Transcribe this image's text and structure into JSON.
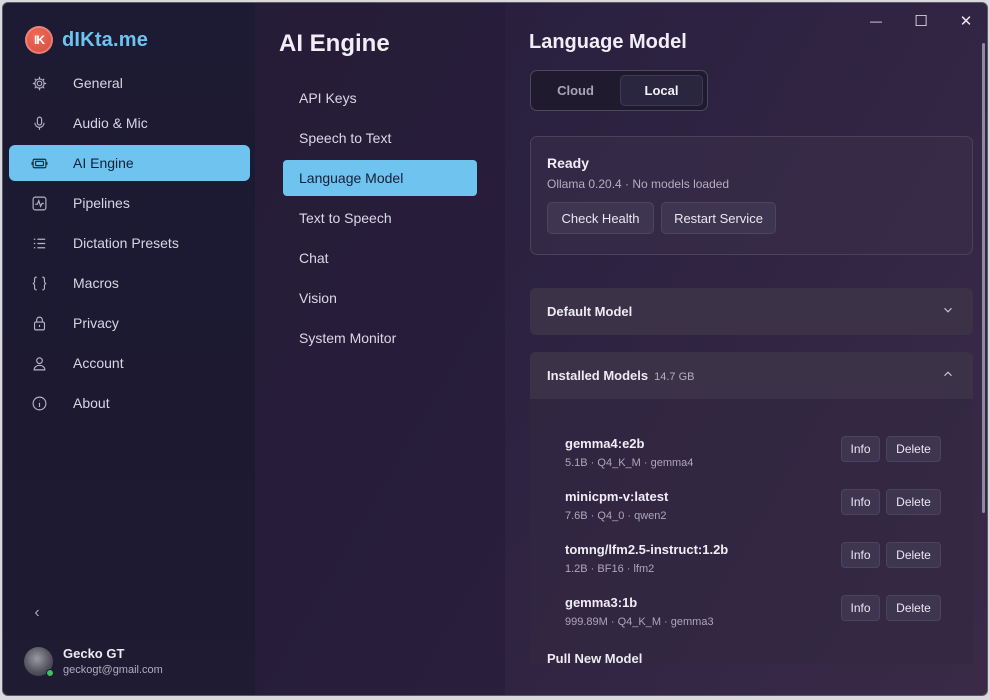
{
  "app": {
    "name": "dIKta.me",
    "logo_text": "IK"
  },
  "sidebar": {
    "items": [
      {
        "label": "General",
        "icon": "gear-icon"
      },
      {
        "label": "Audio & Mic",
        "icon": "microphone-icon"
      },
      {
        "label": "AI Engine",
        "icon": "chip-icon",
        "active": true
      },
      {
        "label": "Pipelines",
        "icon": "activity-icon"
      },
      {
        "label": "Dictation Presets",
        "icon": "list-icon"
      },
      {
        "label": "Macros",
        "icon": "braces-icon"
      },
      {
        "label": "Privacy",
        "icon": "lock-icon"
      },
      {
        "label": "Account",
        "icon": "user-icon"
      },
      {
        "label": "About",
        "icon": "info-icon"
      }
    ],
    "collapse_glyph": "‹"
  },
  "user": {
    "name": "Gecko GT",
    "email": "geckogt@gmail.com"
  },
  "subnav": {
    "title": "AI Engine",
    "items": [
      "API Keys",
      "Speech to Text",
      "Language Model",
      "Text to Speech",
      "Chat",
      "Vision",
      "System Monitor"
    ],
    "active": "Language Model"
  },
  "main": {
    "title": "Language Model",
    "segments": [
      "Cloud",
      "Local"
    ],
    "active_segment": "Local",
    "status": {
      "title": "Ready",
      "meta": "Ollama  0.20.4  ·  No models loaded",
      "check_health": "Check Health",
      "restart_service": "Restart Service"
    },
    "default_model": {
      "label": "Default Model"
    },
    "installed": {
      "label": "Installed Models",
      "size": "14.7 GB",
      "models": [
        {
          "name": "gemma4:e2b",
          "meta": "5.1B  ·  Q4_K_M  ·  gemma4"
        },
        {
          "name": "minicpm-v:latest",
          "meta": "7.6B  ·  Q4_0  ·  qwen2"
        },
        {
          "name": "tomng/lfm2.5-instruct:1.2b",
          "meta": "1.2B  ·  BF16  ·  lfm2"
        },
        {
          "name": "gemma3:1b",
          "meta": "999.89M  ·  Q4_K_M  ·  gemma3"
        }
      ],
      "info_label": "Info",
      "delete_label": "Delete"
    },
    "pull": {
      "label": "Pull New Model"
    }
  },
  "window_controls": {
    "minimize": "—",
    "maximize": "☐",
    "close": "✕"
  }
}
